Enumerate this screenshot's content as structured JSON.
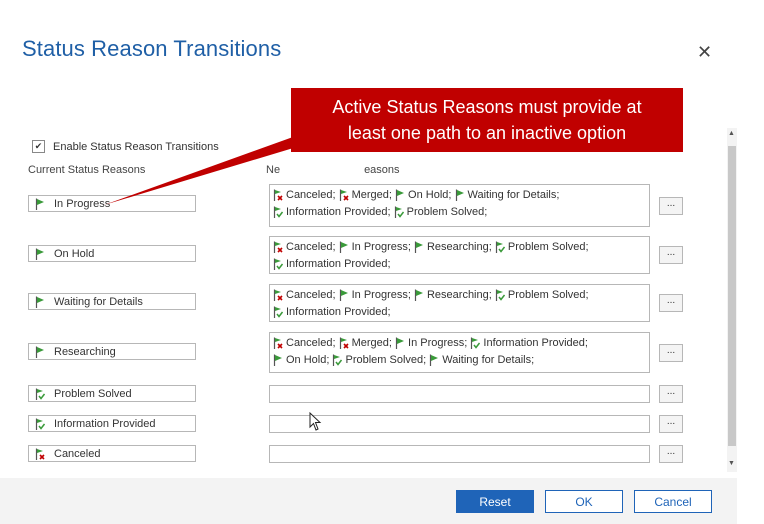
{
  "dialog": {
    "title": "Status Reason Transitions",
    "close_icon": "close-icon"
  },
  "enable_checkbox": {
    "label": "Enable Status Reason Transitions",
    "checked": true
  },
  "headers": {
    "current": "Current Status Reasons",
    "next": "New Status Reasons",
    "next_visible": "N              easons"
  },
  "callout": {
    "line1": "Active Status Reasons must provide at",
    "line2": "least one path to an inactive option"
  },
  "rows": [
    {
      "label": "In Progress",
      "flag": "active",
      "items": [
        {
          "label": "Canceled;",
          "flag": "canceled"
        },
        {
          "label": "Merged;",
          "flag": "canceled"
        },
        {
          "label": "On Hold;",
          "flag": "active"
        },
        {
          "label": "Waiting for Details;",
          "flag": "active"
        },
        {
          "label": "Information Provided;",
          "flag": "resolved"
        },
        {
          "label": "Problem Solved;",
          "flag": "resolved"
        }
      ]
    },
    {
      "label": "On Hold",
      "flag": "active",
      "items": [
        {
          "label": "Canceled;",
          "flag": "canceled"
        },
        {
          "label": "In Progress;",
          "flag": "active"
        },
        {
          "label": "Researching;",
          "flag": "active"
        },
        {
          "label": "Problem Solved;",
          "flag": "resolved"
        },
        {
          "label": "Information Provided;",
          "flag": "resolved"
        }
      ]
    },
    {
      "label": "Waiting for Details",
      "flag": "active",
      "items": [
        {
          "label": "Canceled;",
          "flag": "canceled"
        },
        {
          "label": "In Progress;",
          "flag": "active"
        },
        {
          "label": "Researching;",
          "flag": "active"
        },
        {
          "label": "Problem Solved;",
          "flag": "resolved"
        },
        {
          "label": "Information Provided;",
          "flag": "resolved"
        }
      ]
    },
    {
      "label": "Researching",
      "flag": "active",
      "items": [
        {
          "label": "Canceled;",
          "flag": "canceled"
        },
        {
          "label": "Merged;",
          "flag": "canceled"
        },
        {
          "label": "In Progress;",
          "flag": "active"
        },
        {
          "label": "Information Provided;",
          "flag": "resolved"
        },
        {
          "label": "On Hold;",
          "flag": "active"
        },
        {
          "label": "Problem Solved;",
          "flag": "resolved"
        },
        {
          "label": "Waiting for Details;",
          "flag": "active"
        }
      ]
    },
    {
      "label": "Problem Solved",
      "flag": "resolved",
      "items": []
    },
    {
      "label": "Information Provided",
      "flag": "resolved",
      "items": []
    },
    {
      "label": "Canceled",
      "flag": "canceled",
      "items": []
    }
  ],
  "dots_label": "...",
  "buttons": {
    "reset": "Reset",
    "ok": "OK",
    "cancel": "Cancel"
  },
  "colors": {
    "title": "#1f5fa6",
    "callout": "#c00000",
    "primary": "#1f64b8",
    "flag_green": "#3a9a3a",
    "flag_red": "#c00000"
  }
}
